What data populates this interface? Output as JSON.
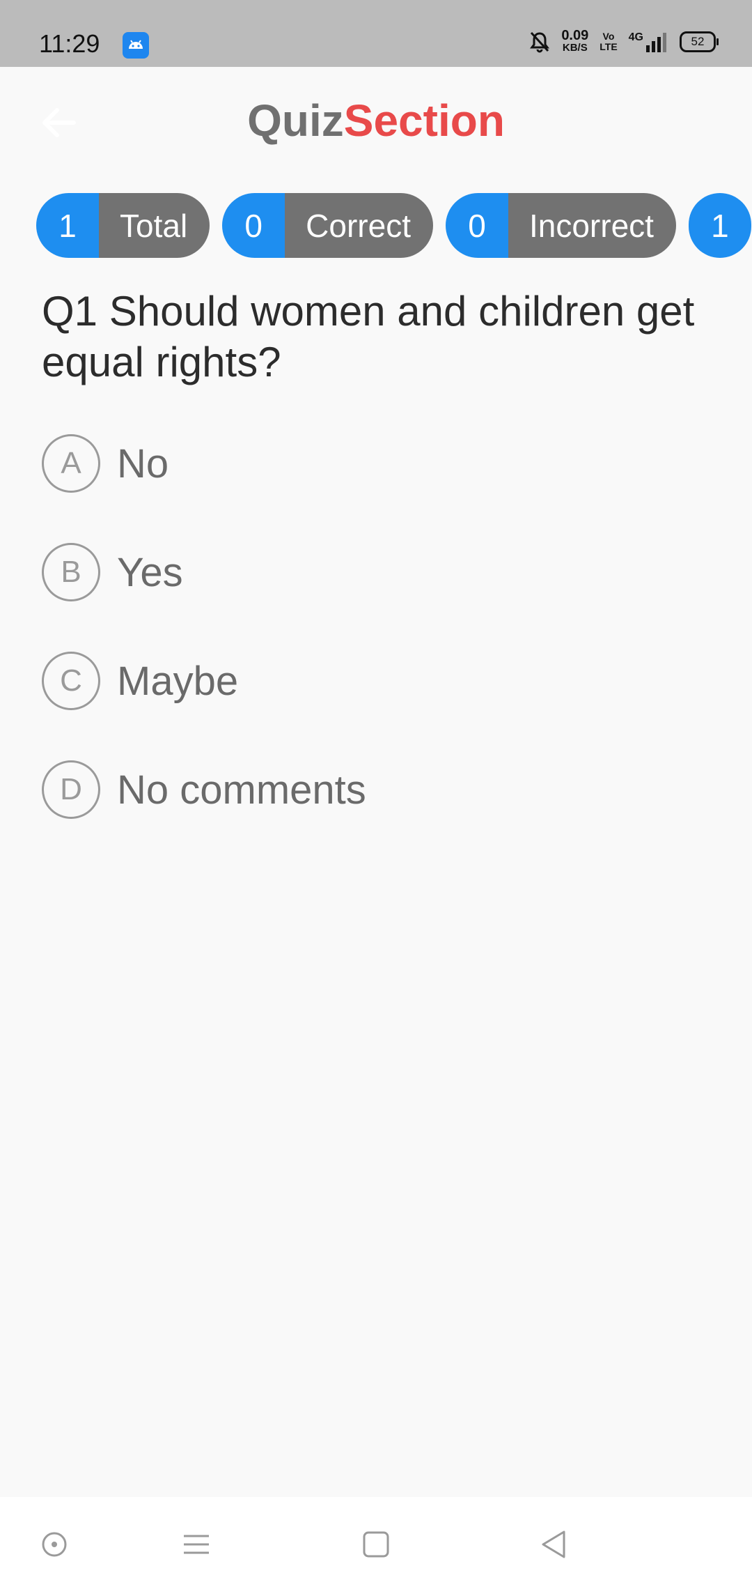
{
  "status_bar": {
    "time": "11:29",
    "net_speed_value": "0.09",
    "net_speed_unit": "KB/S",
    "volte_top": "Vo",
    "volte_bottom": "LTE",
    "network": "4G",
    "battery": "52"
  },
  "header": {
    "title_part1": "Quiz",
    "title_part2": "Section",
    "title_part1_color": "#707070",
    "title_part2_color": "#e84a4a"
  },
  "stats": [
    {
      "value": "1",
      "label": "Total"
    },
    {
      "value": "0",
      "label": "Correct"
    },
    {
      "value": "0",
      "label": "Incorrect"
    },
    {
      "value": "1",
      "label": ""
    }
  ],
  "question": {
    "text": "Q1 Should women and children get equal rights?"
  },
  "options": [
    {
      "letter": "A",
      "text": "No"
    },
    {
      "letter": "B",
      "text": "Yes"
    },
    {
      "letter": "C",
      "text": "Maybe"
    },
    {
      "letter": "D",
      "text": "No comments"
    }
  ],
  "colors": {
    "accent_blue": "#1e8ef0",
    "pill_gray": "#727272",
    "background": "#f9f9f9"
  },
  "icons": {
    "back": "arrow-left-icon",
    "nav_assistant": "circle-dot-icon",
    "nav_menu": "menu-lines-icon",
    "nav_home": "square-icon",
    "nav_back": "triangle-back-icon"
  }
}
